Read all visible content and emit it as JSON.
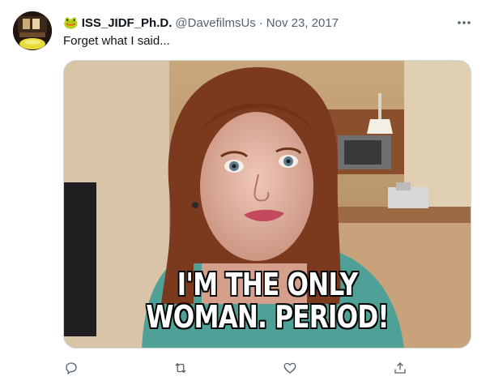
{
  "tweet": {
    "author": {
      "emoji": "🐸",
      "display_name": "ISS_JIDF_Ph.D.",
      "handle": "@DavefilmsUs",
      "separator": "·",
      "date": "Nov 23, 2017"
    },
    "text": "Forget what I said...",
    "media": {
      "caption_line1": "I'M THE ONLY",
      "caption_line2": "WOMAN. PERIOD!"
    },
    "actions": [
      "reply-icon",
      "retweet-icon",
      "like-icon",
      "share-icon"
    ]
  },
  "colors": {
    "text_primary": "#0f1419",
    "text_secondary": "#536471",
    "border": "#cfd9de",
    "icon": "#536471"
  }
}
